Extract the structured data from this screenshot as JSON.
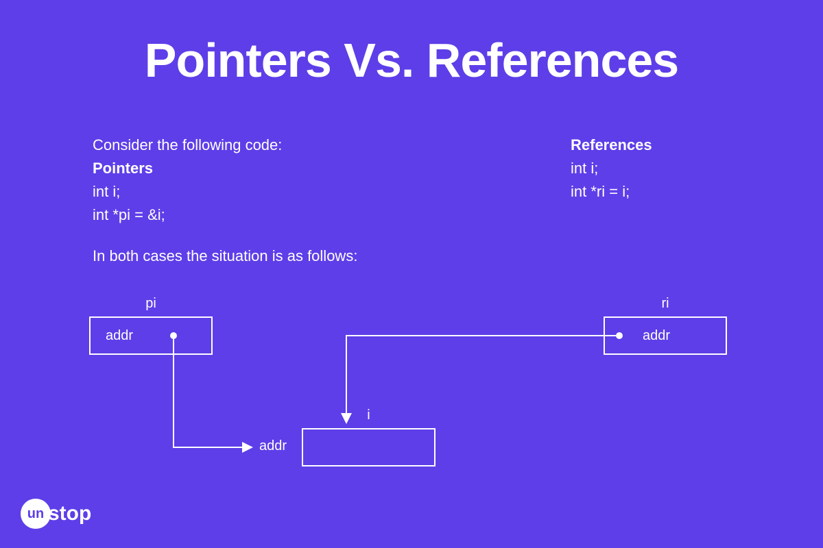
{
  "title": "Pointers Vs. References",
  "intro": "Consider the following code:",
  "pointers": {
    "heading": "Pointers",
    "line1": "int i;",
    "line2": "int *pi = &i;"
  },
  "references": {
    "heading": "References",
    "line1": "int i;",
    "line2": "int *ri = i;"
  },
  "situation": "In both cases the situation is as follows:",
  "diagram": {
    "box_pi": {
      "label": "pi",
      "content": "addr"
    },
    "box_ri": {
      "label": "ri",
      "content": "addr"
    },
    "box_i": {
      "label": "i",
      "addr_label": "addr"
    }
  },
  "logo": {
    "circle": "un",
    "text": "stop"
  }
}
